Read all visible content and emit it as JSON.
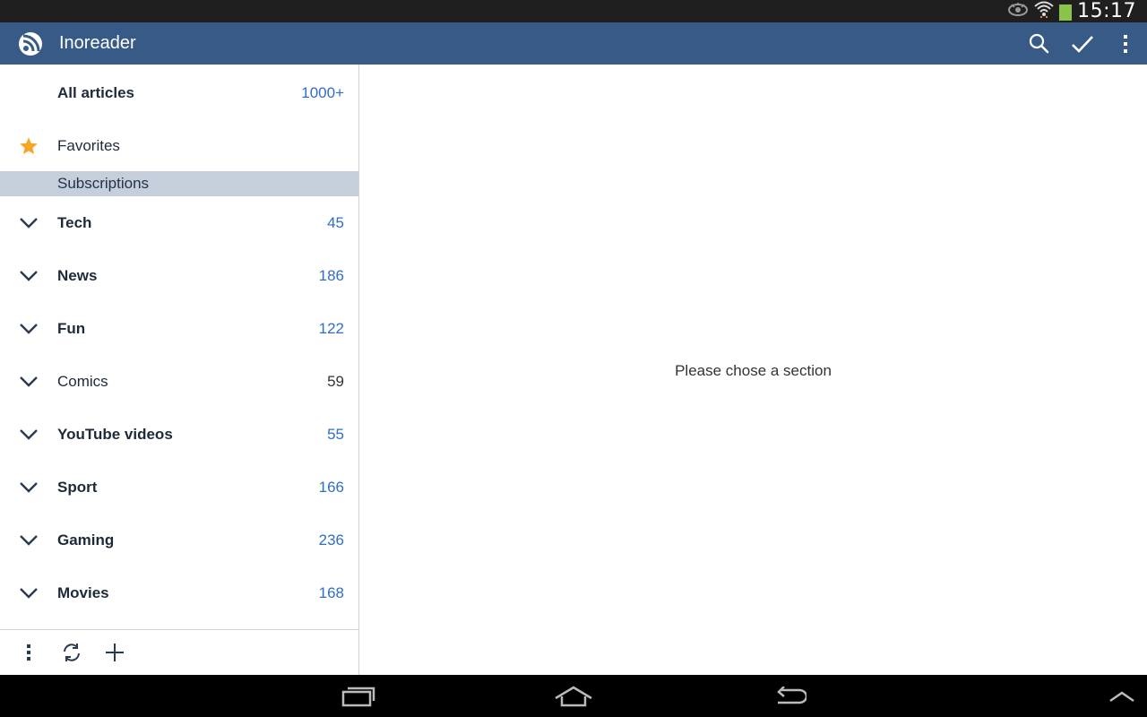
{
  "status_bar": {
    "time": "15:17"
  },
  "app_bar": {
    "title": "Inoreader"
  },
  "sidebar": {
    "all_articles": {
      "label": "All articles",
      "count": "1000+"
    },
    "favorites": {
      "label": "Favorites"
    },
    "section_header": "Subscriptions",
    "folders": [
      {
        "label": "Tech",
        "count": "45"
      },
      {
        "label": "News",
        "count": "186"
      },
      {
        "label": "Fun",
        "count": "122"
      },
      {
        "label": "Comics",
        "count": "59"
      },
      {
        "label": "YouTube videos",
        "count": "55"
      },
      {
        "label": "Sport",
        "count": "166"
      },
      {
        "label": "Gaming",
        "count": "236"
      },
      {
        "label": "Movies",
        "count": "168"
      }
    ]
  },
  "main": {
    "empty_message": "Please chose a section"
  },
  "colors": {
    "app_bar": "#375a86",
    "section_header": "#c5cfdc",
    "count_accent": "#2f6fc3",
    "favorite_star": "#f5a623",
    "battery": "#8bc34a"
  },
  "icons": {
    "status": [
      "eye-icon",
      "wifi-icon",
      "battery-icon"
    ],
    "app_bar": [
      "rss-logo-icon",
      "search-icon",
      "checkmark-icon",
      "overflow-menu-icon"
    ],
    "sidebar_footer": [
      "overflow-menu-icon",
      "refresh-icon",
      "plus-icon"
    ],
    "nav_bar": [
      "recent-apps-icon",
      "home-icon",
      "back-icon",
      "chevron-up-icon"
    ]
  }
}
